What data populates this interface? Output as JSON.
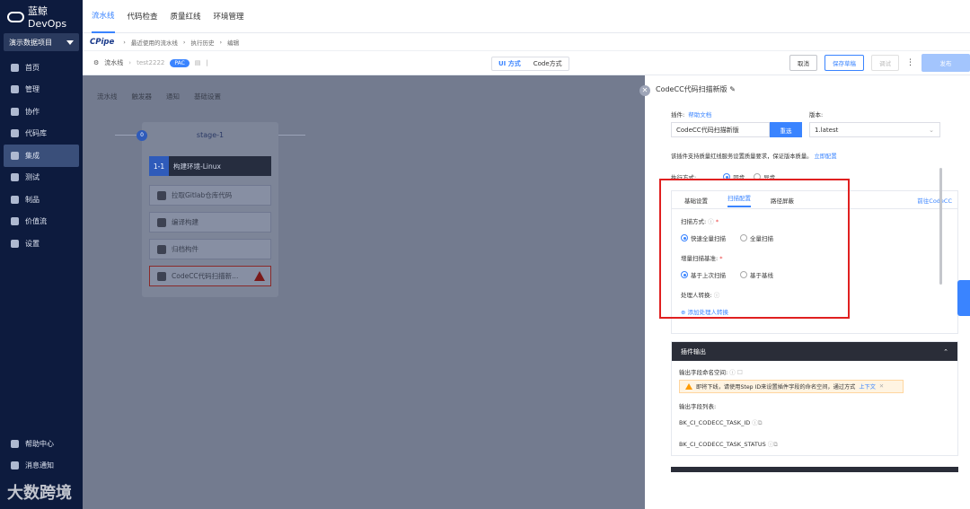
{
  "sidebar": {
    "brand": "蓝鲸DevOps",
    "project": "演示数据项目",
    "items": [
      {
        "label": "首页",
        "icon": "home-icon"
      },
      {
        "label": "管理",
        "icon": "grid-icon"
      },
      {
        "label": "协作",
        "icon": "collab-icon"
      },
      {
        "label": "代码库",
        "icon": "repo-icon"
      },
      {
        "label": "集成",
        "icon": "integration-icon"
      },
      {
        "label": "测试",
        "icon": "test-icon"
      },
      {
        "label": "制品",
        "icon": "artifact-icon"
      },
      {
        "label": "价值流",
        "icon": "value-stream-icon"
      },
      {
        "label": "设置",
        "icon": "gear-icon"
      }
    ],
    "help": "帮助中心",
    "notify": "消息通知",
    "watermark": "大数跨境"
  },
  "topnav": {
    "tabs": [
      "流水线",
      "代码检查",
      "质量红线",
      "环境管理"
    ]
  },
  "breadcrumb": {
    "brand": "CPipe",
    "items": [
      "最近使用的流水线",
      "执行历史",
      "编辑"
    ]
  },
  "toolbar": {
    "pipeline": "流水线",
    "name": "test2222",
    "pac": "PAC",
    "mode_ui": "UI 方式",
    "mode_code": "Code方式",
    "cancel": "取消",
    "save_draft": "保存草稿",
    "debug": "调试",
    "more": "⋮",
    "publish": "发布"
  },
  "canvas": {
    "tabs": [
      "流水线",
      "触发器",
      "通知",
      "基础设置"
    ],
    "stage": {
      "title": "stage-1",
      "num": "0"
    },
    "job": {
      "idx": "1-1",
      "title": "构建环境-Linux"
    },
    "tasks": [
      "拉取Gitlab仓库代码",
      "编译构建",
      "归档构件",
      "CodeCC代码扫描新..."
    ]
  },
  "panel": {
    "title": "CodeCC代码扫描新版",
    "plugin_label": "插件:",
    "help_doc": "帮助文档",
    "plugin_name": "CodeCC代码扫描新版",
    "reselect": "重选",
    "version_label": "版本:",
    "version": "1.latest",
    "quality_note": "该插件支持质量红线服务设置质量要求，保证版本质量。",
    "quality_link": "立即配置",
    "exec_label": "执行方式:",
    "exec_sync": "同步",
    "exec_async": "异步",
    "subtabs": [
      "基础设置",
      "扫描配置",
      "路径屏蔽"
    ],
    "goto": "前往CodeCC",
    "scan_mode_label": "扫描方式:",
    "scan_fast": "快速全量扫描",
    "scan_full": "全量扫描",
    "incr_label": "增量扫描基准:",
    "incr_last": "基于上次扫描",
    "incr_base": "基于基线",
    "handler_label": "处理人转换:",
    "add_handler": "添加处理人转换",
    "output_title": "插件输出",
    "namespace_label": "输出字段命名空间:",
    "notice": "即将下线，请使用Step ID来设置插件字段的命名空间，通过方式",
    "notice_link": "上下文",
    "fields_label": "输出字段列表:",
    "fields": [
      "BK_CI_CODECC_TASK_ID",
      "BK_CI_CODECC_TASK_STATUS"
    ]
  }
}
